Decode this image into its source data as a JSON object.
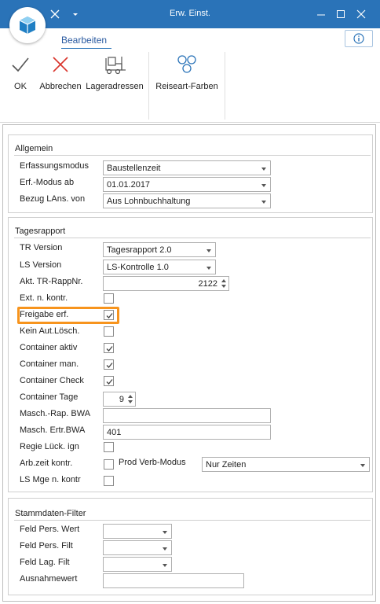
{
  "window": {
    "title": "Erw. Einst.",
    "qa_close_icon": "x-icon",
    "qa_dropdown_icon": "chevron-down-icon"
  },
  "ribbon": {
    "tab_label": "Bearbeiten",
    "buttons": [
      {
        "label": "OK",
        "icon": "check-icon"
      },
      {
        "label": "Abbrechen",
        "icon": "cancel-x-icon"
      },
      {
        "label": "Lageradressen",
        "icon": "forklift-icon"
      },
      {
        "label": "Reiseart-Farben",
        "icon": "circles-icon"
      }
    ]
  },
  "allgemein": {
    "title": "Allgemein",
    "erfassungsmodus": {
      "label": "Erfassungsmodus",
      "value": "Baustellenzeit"
    },
    "erf_modus_ab": {
      "label": "Erf.-Modus ab",
      "value": "01.01.2017"
    },
    "bezug_lans": {
      "label": "Bezug LAns. von",
      "value": "Aus Lohnbuchhaltung"
    }
  },
  "tagesrapport": {
    "title": "Tagesrapport",
    "tr_version": {
      "label": "TR Version",
      "value": "Tagesrapport 2.0"
    },
    "ls_version": {
      "label": "LS Version",
      "value": "LS-Kontrolle 1.0"
    },
    "akt_tr_rappnr": {
      "label": "Akt. TR-RappNr.",
      "value": "2122"
    },
    "ext_n_kontr": {
      "label": "Ext. n. kontr.",
      "checked": false
    },
    "freigabe_erf": {
      "label": "Freigabe erf.",
      "checked": true
    },
    "kein_aut_losch": {
      "label": "Kein Aut.Lösch.",
      "checked": false
    },
    "container_aktiv": {
      "label": "Container aktiv",
      "checked": true
    },
    "container_man": {
      "label": "Container man.",
      "checked": true
    },
    "container_check": {
      "label": "Container Check",
      "checked": true
    },
    "container_tage": {
      "label": "Container Tage",
      "value": "9"
    },
    "masch_rap_bwa": {
      "label": "Masch.-Rap. BWA",
      "value": ""
    },
    "masch_ertr_bwa": {
      "label": "Masch. Ertr.BWA",
      "value": "401"
    },
    "regie_luck_ign": {
      "label": "Regie Lück. ign",
      "checked": false
    },
    "arb_zeit_kontr": {
      "label": "Arb.zeit kontr.",
      "checked": false
    },
    "prod_verb_modus": {
      "label": "Prod Verb-Modus",
      "value": "Nur Zeiten"
    },
    "ls_mge_n_kontr": {
      "label": "LS Mge n. kontr",
      "checked": false
    }
  },
  "stammdaten": {
    "title": "Stammdaten-Filter",
    "feld_pers_wert": {
      "label": "Feld Pers. Wert",
      "value": ""
    },
    "feld_pers_filt": {
      "label": "Feld Pers. Filt",
      "value": ""
    },
    "feld_lag_filt": {
      "label": "Feld Lag. Filt",
      "value": ""
    },
    "ausnahmewert": {
      "label": "Ausnahmewert",
      "value": ""
    }
  },
  "colors": {
    "titlebar": "#2a73b8",
    "highlight": "#f7941d",
    "cancel_red": "#d9342b"
  }
}
